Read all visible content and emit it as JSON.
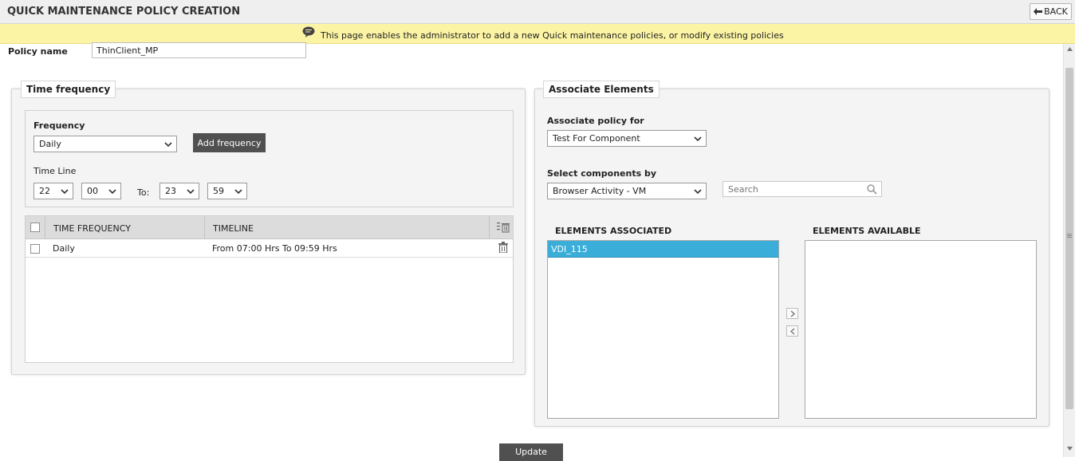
{
  "header": {
    "title": "QUICK MAINTENANCE POLICY CREATION",
    "back_label": "BACK"
  },
  "info": {
    "message": "This page enables the administrator to add a new Quick maintenance policies, or modify existing policies"
  },
  "policy": {
    "label": "Policy name",
    "value": "ThinClient_MP"
  },
  "time_frequency": {
    "legend": "Time frequency",
    "frequency_label": "Frequency",
    "frequency_value": "Daily",
    "add_label": "Add frequency",
    "timeline_label": "Time Line",
    "from_hour": "22",
    "from_min": "00",
    "to_label": "To:",
    "to_hour": "23",
    "to_min": "59",
    "table": {
      "col_freq": "TIME FREQUENCY",
      "col_timeline": "TIMELINE",
      "rows": [
        {
          "frequency": "Daily",
          "timeline": "From 07:00 Hrs To 09:59 Hrs"
        }
      ]
    }
  },
  "associate": {
    "legend": "Associate Elements",
    "policy_for_label": "Associate policy for",
    "policy_for_value": "Test For Component",
    "select_by_label": "Select components by",
    "select_by_value": "Browser Activity - VM",
    "search_placeholder": "Search",
    "associated_title": "ELEMENTS ASSOCIATED",
    "available_title": "ELEMENTS AVAILABLE",
    "associated_items": [
      "VDI_115"
    ],
    "selection_color": "#3aaed8"
  },
  "footer": {
    "update_label": "Update"
  }
}
